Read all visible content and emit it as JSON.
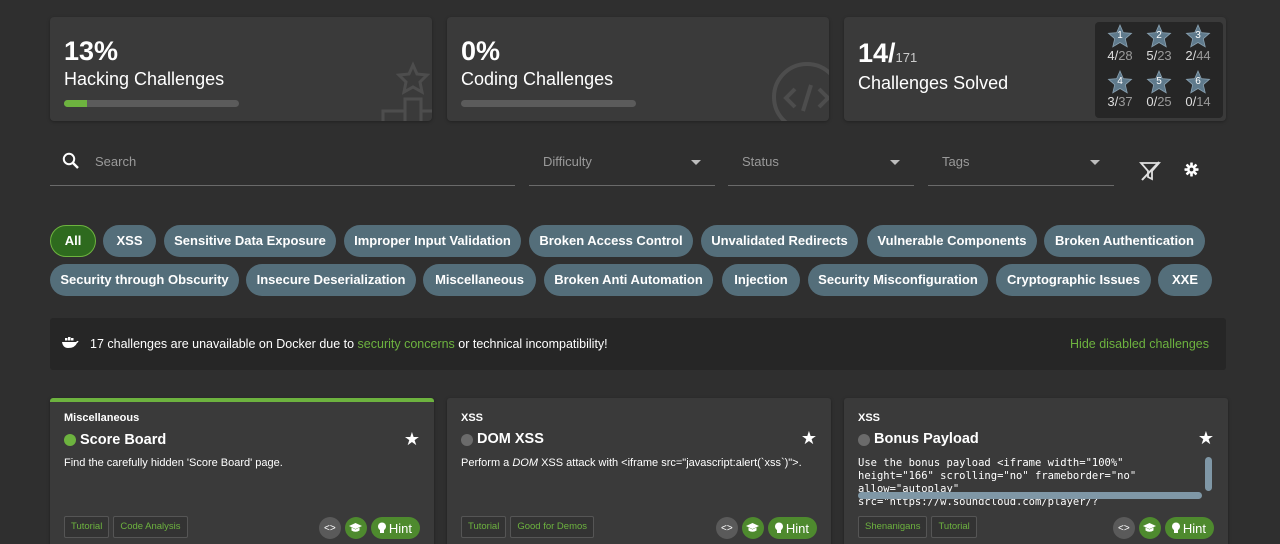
{
  "stats": {
    "hacking": {
      "percent": "13%",
      "label": "Hacking Challenges",
      "progress": 0.13
    },
    "coding": {
      "percent": "0%",
      "label": "Coding Challenges",
      "progress": 0.0
    },
    "solved": {
      "count": "14/",
      "total": "171",
      "label": "Challenges Solved"
    }
  },
  "difficulty_stars": [
    {
      "level": "1",
      "solved": "4/",
      "total": "28"
    },
    {
      "level": "2",
      "solved": "5/",
      "total": "23"
    },
    {
      "level": "3",
      "solved": "2/",
      "total": "44"
    },
    {
      "level": "4",
      "solved": "3/",
      "total": "37"
    },
    {
      "level": "5",
      "solved": "0/",
      "total": "25"
    },
    {
      "level": "6",
      "solved": "0/",
      "total": "14"
    }
  ],
  "filters": {
    "search_placeholder": "Search",
    "difficulty_placeholder": "Difficulty",
    "status_placeholder": "Status",
    "tags_placeholder": "Tags"
  },
  "categories": [
    "All",
    "XSS",
    "Sensitive Data Exposure",
    "Improper Input Validation",
    "Broken Access Control",
    "Unvalidated Redirects",
    "Vulnerable Components",
    "Broken Authentication",
    "Security through Obscurity",
    "Insecure Deserialization",
    "Miscellaneous",
    "Broken Anti Automation",
    "Injection",
    "Security Misconfiguration",
    "Cryptographic Issues",
    "XXE"
  ],
  "banner": {
    "text_before": "17 challenges are unavailable on Docker due to ",
    "link": "security concerns",
    "text_after": " or technical incompatibility!",
    "hide_link": "Hide disabled challenges"
  },
  "challenges": [
    {
      "category": "Miscellaneous",
      "name": "Score Board",
      "solved": true,
      "desc_a": "Find the carefully hidden 'Score Board' page.",
      "desc_b": "",
      "desc_c": "",
      "tags": [
        "Tutorial",
        "Code Analysis"
      ],
      "hint": "Hint"
    },
    {
      "category": "XSS",
      "name": "DOM XSS",
      "solved": false,
      "desc_a": "Perform a ",
      "desc_b": "DOM",
      "desc_c": " XSS attack with <iframe src=\"javascript:alert(`xss`)\">.",
      "tags": [
        "Tutorial",
        "Good for Demos"
      ],
      "hint": "Hint"
    },
    {
      "category": "XSS",
      "name": "Bonus Payload",
      "solved": false,
      "desc_a": "Use the bonus payload <iframe width=\"100%\" height=\"166\" scrolling=\"no\" frameborder=\"no\" allow=\"autoplay\" src=\"https://w.soundcloud.com/player/?",
      "desc_b": "",
      "desc_c": "",
      "tags": [
        "Shenanigans",
        "Tutorial"
      ],
      "hint": "Hint"
    }
  ],
  "colors": {
    "accent": "#6db33f",
    "chip": "#546e7a",
    "background": "#2f2f2f",
    "card": "#3a3a3a"
  }
}
